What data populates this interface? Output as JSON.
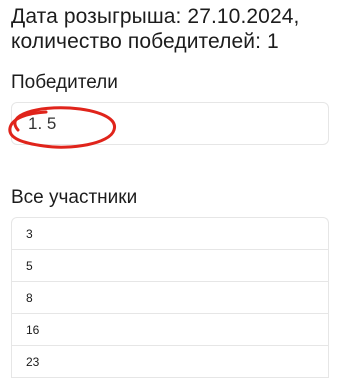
{
  "header": {
    "line1": "Дата розыгрыша: 27.10.2024,",
    "line2": "количество победителей: 1"
  },
  "winners": {
    "heading": "Победители",
    "items": [
      "1. 5"
    ]
  },
  "participants": {
    "heading": "Все участники",
    "items": [
      "3",
      "5",
      "8",
      "16",
      "23"
    ]
  },
  "annotation": {
    "color": "#e0241b"
  }
}
